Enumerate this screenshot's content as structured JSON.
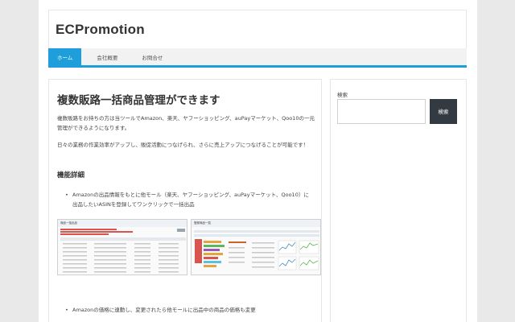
{
  "site": {
    "title": "ECPromotion"
  },
  "nav": {
    "items": [
      {
        "label": "ホーム",
        "active": true
      },
      {
        "label": "会社概要",
        "active": false
      },
      {
        "label": "お問合せ",
        "active": false
      }
    ],
    "accent": "#1e9fdc"
  },
  "main": {
    "title": "複数販路一括商品管理ができます",
    "paragraphs": [
      "複数販路をお持ちの方は当ツールでAmazon、楽天、ヤフーショッピング、auPayマーケット、Qoo10の一元管理ができるようになります。",
      "日々の業務の作業効率がアップし、販促活動につなげられ、さらに売上アップにつなげることが可能です！"
    ],
    "section_heading": "機能詳細",
    "bullets": [
      "Amazonの出品情報をもとに他モール（楽天、ヤフーショッピング、auPayマーケット、Qoo10）に出品したいASINを登録してワンクリックで一括出品",
      "Amazonの価格に連動し、変更されたら他モールに出品中の商品の価格も変更"
    ],
    "screenshots": [
      {
        "title": "商品一括出品"
      },
      {
        "title": "登録商品一覧"
      }
    ]
  },
  "sidebar": {
    "search_label": "検索",
    "search_value": "",
    "search_button": "検索"
  }
}
